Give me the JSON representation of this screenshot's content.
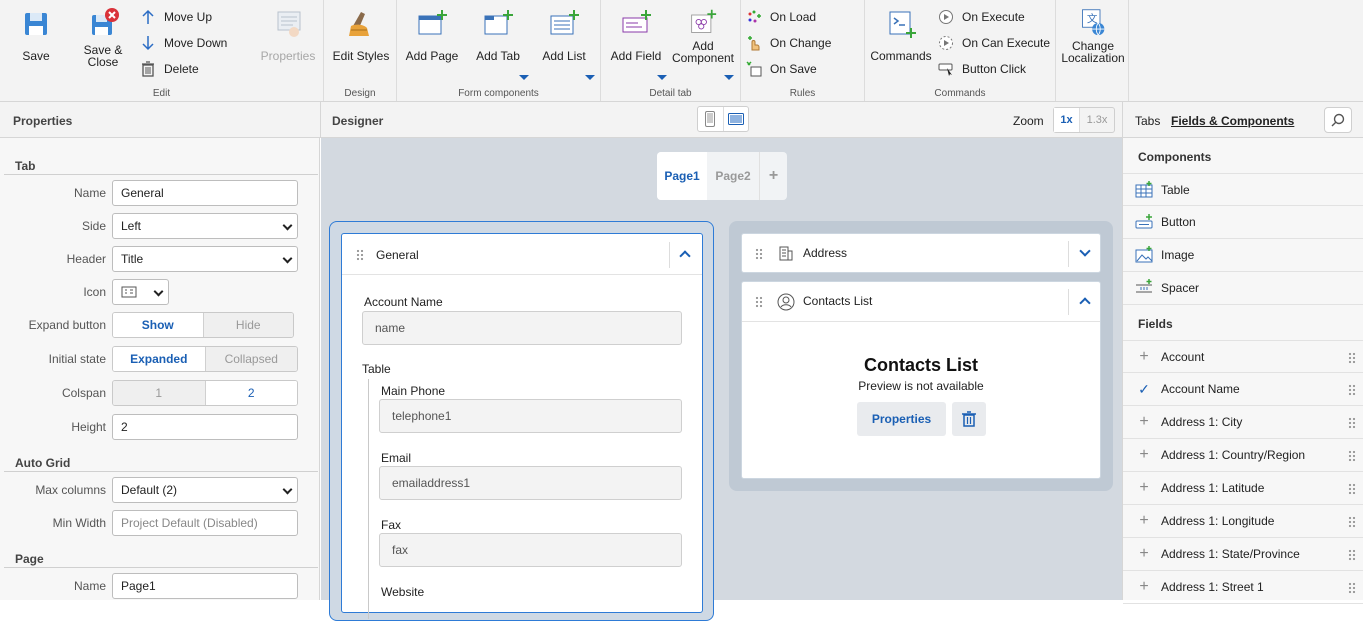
{
  "ribbon": {
    "edit": {
      "label": "Edit",
      "save": "Save",
      "save_close_1": "Save &",
      "save_close_2": "Close",
      "move_up": "Move Up",
      "move_down": "Move Down",
      "delete": "Delete",
      "properties": "Properties"
    },
    "design": {
      "label": "Design",
      "edit_styles": "Edit Styles"
    },
    "form_components": {
      "label": "Form components",
      "add_page": "Add Page",
      "add_tab": "Add Tab",
      "add_list": "Add List"
    },
    "detail_tab": {
      "label": "Detail tab",
      "add_field": "Add Field",
      "add_component_1": "Add",
      "add_component_2": "Component"
    },
    "rules": {
      "label": "Rules",
      "on_load": "On Load",
      "on_change": "On Change",
      "on_save": "On Save"
    },
    "commands": {
      "label": "Commands",
      "commands": "Commands",
      "on_execute": "On Execute",
      "on_can_execute": "On Can Execute",
      "button_click": "Button Click"
    },
    "localization": {
      "change_1": "Change",
      "change_2": "Localization"
    }
  },
  "headers": {
    "properties": "Properties",
    "designer": "Designer",
    "zoom": "Zoom",
    "zoom_1x": "1x",
    "zoom_13x": "1.3x",
    "tabs": "Tabs",
    "fields_components": "Fields & Components"
  },
  "properties": {
    "tab_section": "Tab",
    "name_label": "Name",
    "name_value": "General",
    "side_label": "Side",
    "side_value": "Left",
    "header_label": "Header",
    "header_value": "Title",
    "icon_label": "Icon",
    "expand_label": "Expand button",
    "expand_show": "Show",
    "expand_hide": "Hide",
    "initial_label": "Initial state",
    "initial_expanded": "Expanded",
    "initial_collapsed": "Collapsed",
    "colspan_label": "Colspan",
    "colspan_1": "1",
    "colspan_2": "2",
    "height_label": "Height",
    "height_value": "2",
    "autogrid_section": "Auto Grid",
    "maxcols_label": "Max columns",
    "maxcols_value": "Default (2)",
    "minwidth_label": "Min Width",
    "minwidth_placeholder": "Project Default (Disabled)",
    "page_section": "Page",
    "page_name_label": "Name",
    "page_name_value": "Page1"
  },
  "designer": {
    "page_tabs": [
      "Page1",
      "Page2"
    ],
    "add_page": "+",
    "general": {
      "title": "General",
      "account_name_label": "Account Name",
      "account_name_value": "name",
      "table_label": "Table",
      "main_phone_label": "Main Phone",
      "main_phone_value": "telephone1",
      "email_label": "Email",
      "email_value": "emailaddress1",
      "fax_label": "Fax",
      "fax_value": "fax",
      "website_label": "Website"
    },
    "address": {
      "title": "Address"
    },
    "contacts": {
      "title": "Contacts List",
      "heading": "Contacts List",
      "sub": "Preview is not available",
      "properties_btn": "Properties"
    }
  },
  "right": {
    "components_section": "Components",
    "components": [
      "Table",
      "Button",
      "Image",
      "Spacer"
    ],
    "fields_section": "Fields",
    "fields": [
      "Account",
      "Account Name",
      "Address 1: City",
      "Address 1: Country/Region",
      "Address 1: Latitude",
      "Address 1: Longitude",
      "Address 1: State/Province",
      "Address 1: Street 1"
    ]
  },
  "colors": {
    "accent": "#1a5fb4",
    "designer_bg": "#d3d9e0",
    "panel_bg": "#f7f7f7"
  }
}
